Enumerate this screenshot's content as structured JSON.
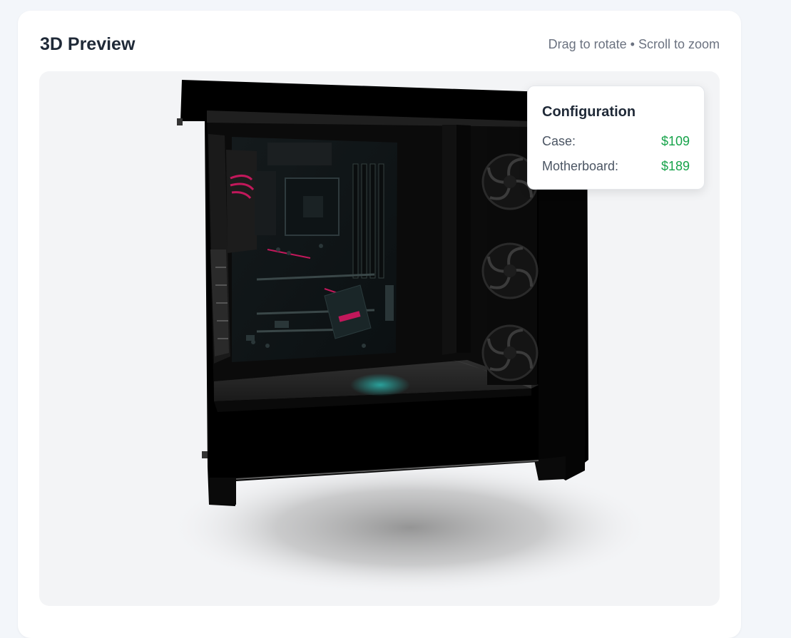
{
  "preview": {
    "title": "3D Preview",
    "hint": "Drag to rotate • Scroll to zoom"
  },
  "configuration": {
    "title": "Configuration",
    "items": [
      {
        "label": "Case:",
        "price": "$109"
      },
      {
        "label": "Motherboard:",
        "price": "$189"
      }
    ]
  },
  "colors": {
    "accent_price": "#16a34a",
    "case_body": "#000000",
    "motherboard_accent": "#c2185b",
    "rgb_glow": "#2bb7b0"
  },
  "icons": [
    "fan-icon"
  ]
}
